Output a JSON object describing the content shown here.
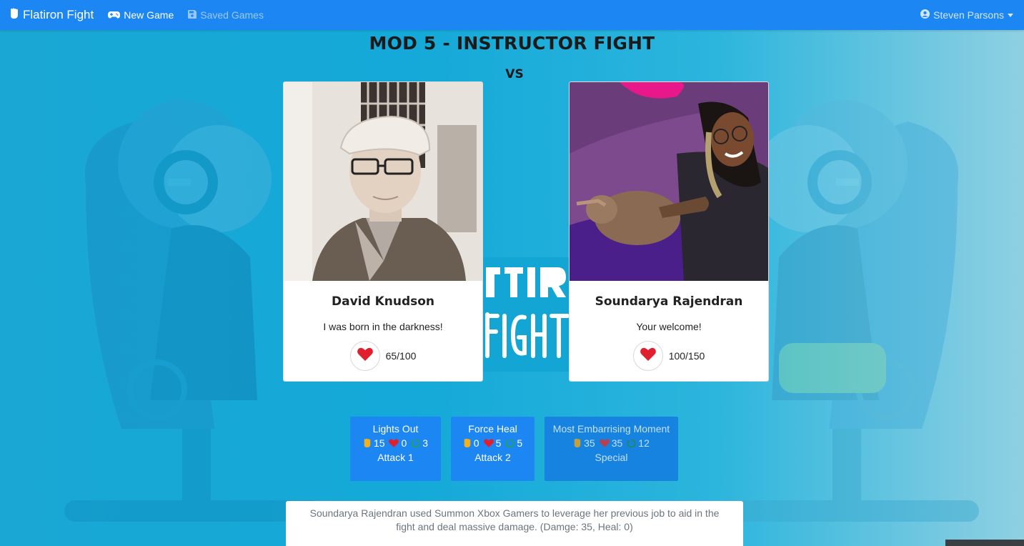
{
  "navbar": {
    "brand": "Flatiron Fight",
    "brand_icon": "fist-icon",
    "new_game": "New Game",
    "new_game_icon": "gamepad-icon",
    "saved_games": "Saved Games",
    "saved_games_icon": "save-icon",
    "user": "Steven Parsons",
    "user_icon": "user-circle-icon"
  },
  "title": "MOD 5 - INSTRUCTOR FIGHT",
  "vs": "VS",
  "fighters": [
    {
      "name": "David Knudson",
      "quote": "I was born in the darkness!",
      "hp": "65/100"
    },
    {
      "name": "Soundarya Rajendran",
      "quote": "Your welcome!",
      "hp": "100/150"
    }
  ],
  "moves": [
    {
      "name": "Lights Out",
      "attack": "15",
      "heal": "0",
      "cooldown": "3",
      "type": "Attack 1"
    },
    {
      "name": "Force Heal",
      "attack": "0",
      "heal": "5",
      "cooldown": "5",
      "type": "Attack 2"
    },
    {
      "name": "Most Embarrising Moment",
      "attack": "35",
      "heal": "35",
      "cooldown": "12",
      "type": "Special"
    }
  ],
  "log": "Soundarya Rajendran used Summon Xbox Gamers to leverage her previous job to aid in the fight and deal massive damage. (Damge: 35, Heal: 0)",
  "colors": {
    "navbar": "#1c86f2",
    "move_button": "#1c86f2",
    "heart": "#e0202e",
    "cooldown": "#1fa35a",
    "attack": "#f0b020"
  }
}
